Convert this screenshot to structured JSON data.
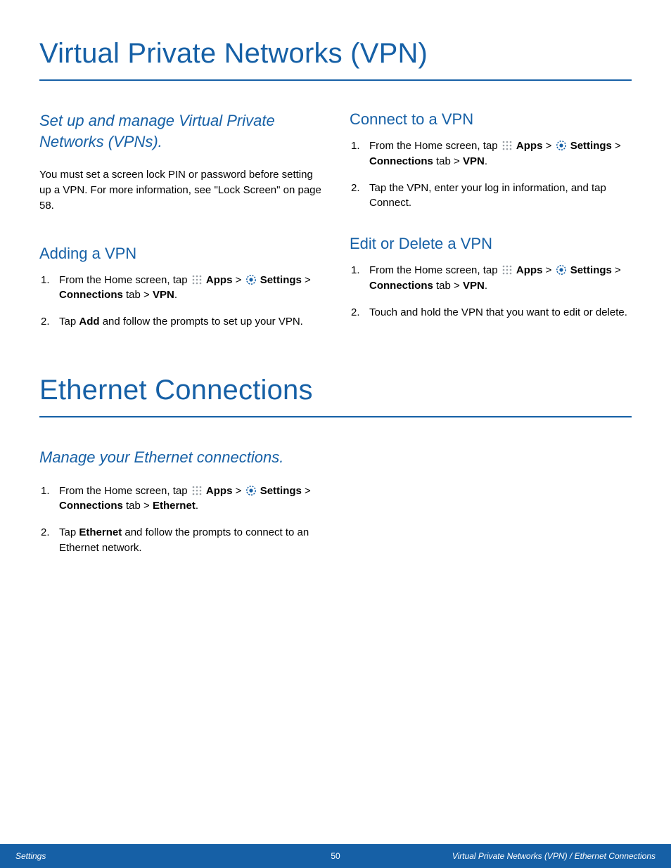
{
  "section_vpn": {
    "title": "Virtual Private Networks (VPN)",
    "subtitle": "Set up and manage Virtual Private Networks (VPNs).",
    "intro": "You must set a screen lock PIN or password before setting up a VPN. For more information, see \"Lock Screen\" on page 58.",
    "adding": {
      "heading": "Adding a VPN",
      "step1_a": "From the Home screen, tap ",
      "step1_apps": "Apps",
      "step1_gt1": " > ",
      "step1_settings": "Settings",
      "step1_gt2": " > ",
      "step1_connections": "Connections",
      "step1_tab": " tab > ",
      "step1_vpn": "VPN",
      "step1_period": ".",
      "step2_a": "Tap ",
      "step2_add": "Add",
      "step2_b": " and follow the prompts to set up your VPN."
    },
    "connect": {
      "heading": "Connect to a VPN",
      "step1_a": "From the Home screen, tap ",
      "step1_apps": "Apps",
      "step1_gt1": " > ",
      "step1_settings": "Settings",
      "step1_gt2": " > ",
      "step1_connections": "Connections",
      "step1_tab": " tab > ",
      "step1_vpn": "VPN",
      "step1_period": ".",
      "step2": "Tap the VPN, enter your log in information, and tap Connect."
    },
    "edit": {
      "heading": "Edit or Delete a VPN",
      "step1_a": "From the Home screen, tap ",
      "step1_apps": "Apps",
      "step1_gt1": " > ",
      "step1_settings": "Settings",
      "step1_gt2": " > ",
      "step1_connections": "Connections",
      "step1_tab": " tab > ",
      "step1_vpn": "VPN",
      "step1_period": ".",
      "step2": "Touch and hold the VPN that you want to edit or delete."
    }
  },
  "section_eth": {
    "title": "Ethernet Connections",
    "subtitle": "Manage your Ethernet connections.",
    "step1_a": "From the Home screen, tap ",
    "step1_apps": "Apps",
    "step1_gt1": " > ",
    "step1_settings": "Settings",
    "step1_gt2": " > ",
    "step1_connections": "Connections",
    "step1_tab": " tab > ",
    "step1_eth": "Ethernet",
    "step1_period": ".",
    "step2_a": "Tap ",
    "step2_eth": "Ethernet",
    "step2_b": " and follow the prompts to connect to an Ethernet network."
  },
  "footer": {
    "left": "Settings",
    "center": "50",
    "right": "Virtual Private Networks (VPN) / Ethernet Connections"
  }
}
